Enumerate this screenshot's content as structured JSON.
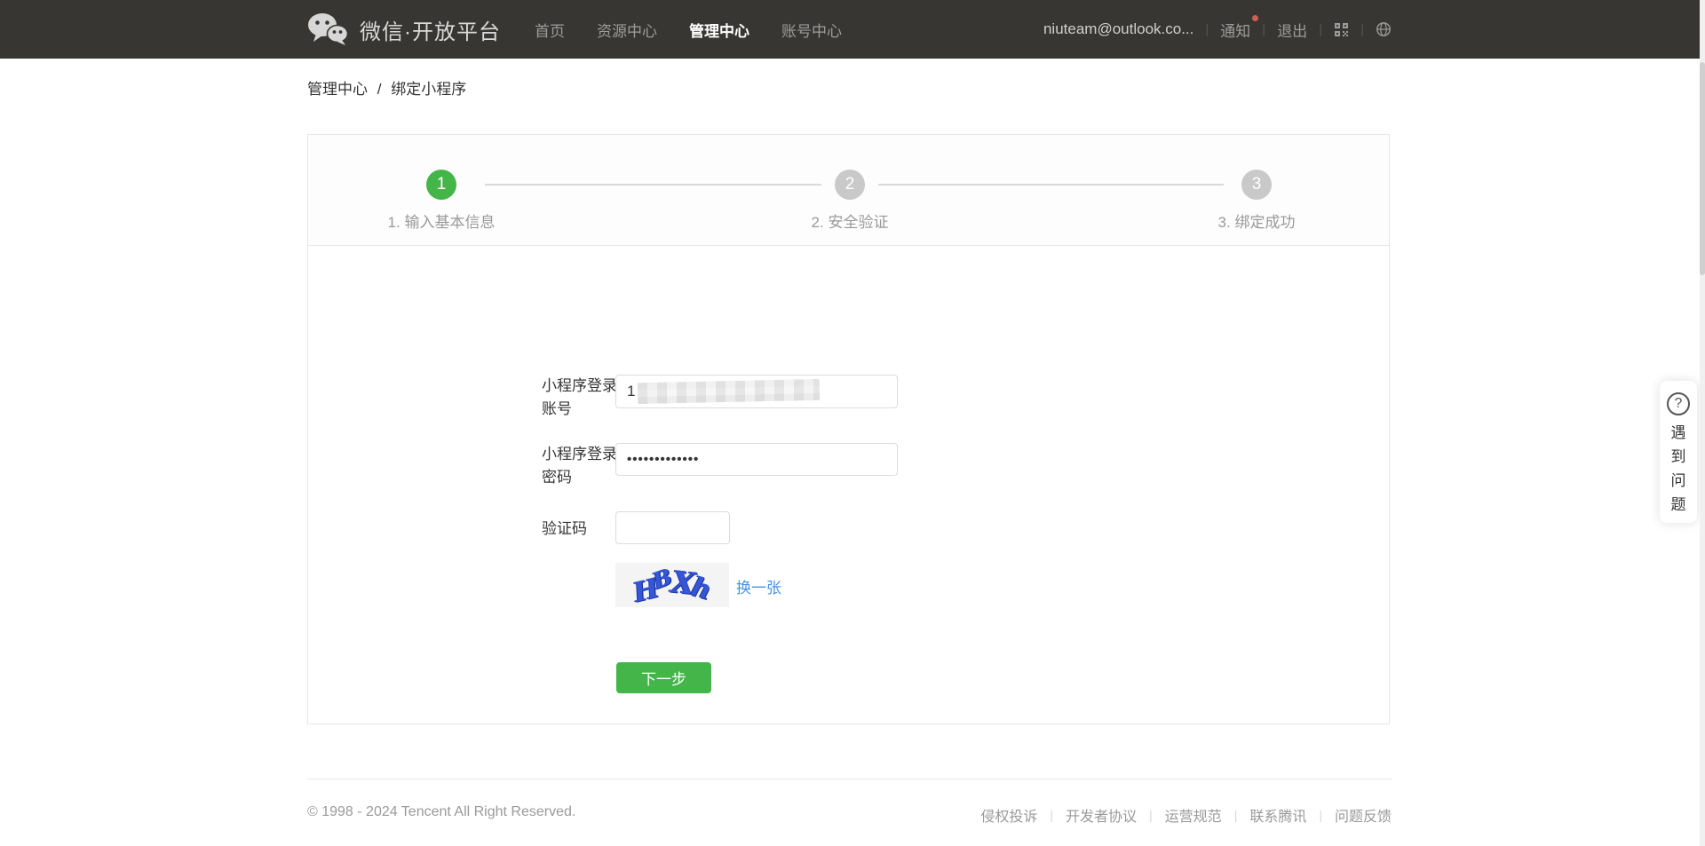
{
  "header": {
    "brand": "微信·开放平台",
    "nav": [
      {
        "label": "首页",
        "active": false
      },
      {
        "label": "资源中心",
        "active": false
      },
      {
        "label": "管理中心",
        "active": true
      },
      {
        "label": "账号中心",
        "active": false
      }
    ],
    "account_email": "niuteam@outlook.co...",
    "notice_label": "通知",
    "logout_label": "退出",
    "divider": "|"
  },
  "breadcrumb": {
    "parent": "管理中心",
    "separator": "/",
    "current": "绑定小程序"
  },
  "steps": [
    {
      "number": "1",
      "label": "1. 输入基本信息",
      "state": "active"
    },
    {
      "number": "2",
      "label": "2. 安全验证",
      "state": "pending"
    },
    {
      "number": "3",
      "label": "3. 绑定成功",
      "state": "pending"
    }
  ],
  "form": {
    "account": {
      "label_line1": "小程序登录",
      "label_line2": "账号",
      "value_visible": "1",
      "value_redacted": true
    },
    "password": {
      "label_line1": "小程序登录",
      "label_line2": "密码",
      "value": "•••••••••••••"
    },
    "captcha": {
      "label": "验证码",
      "value": "",
      "image_text": "HBXh",
      "letters": [
        "H",
        "B",
        "X",
        "h"
      ],
      "refresh_label": "换一张"
    },
    "submit_label": "下一步"
  },
  "help_widget": {
    "icon": "?",
    "chars": [
      "遇",
      "到",
      "问",
      "题"
    ]
  },
  "footer": {
    "copyright": "© 1998 - 2024 Tencent All Right Reserved.",
    "links": [
      "侵权投诉",
      "开发者协议",
      "运营规范",
      "联系腾讯",
      "问题反馈"
    ],
    "divider": "|"
  },
  "colors": {
    "header_bg": "#383632",
    "accent_green": "#44b549",
    "link_blue": "#4a90e2",
    "notice_dot_red": "#cf5f50",
    "step_pending_gray": "#c9c9c9"
  }
}
